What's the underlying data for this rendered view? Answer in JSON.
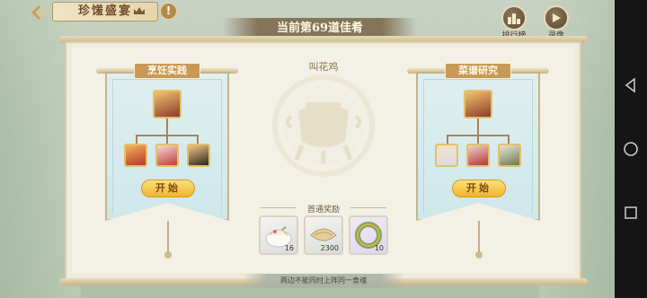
{
  "header": {
    "title": "珍馐盛宴",
    "round_banner": "当前第69道佳肴",
    "info_glyph": "!",
    "buttons": [
      {
        "label": "排行榜",
        "icon": "leaderboard-icon"
      },
      {
        "label": "录像",
        "icon": "play-icon"
      }
    ]
  },
  "dish": {
    "name": "叫花鸡"
  },
  "teams": {
    "left": {
      "heading": "烹饪实践",
      "start_label": "开始"
    },
    "right": {
      "heading": "菜谱研究",
      "start_label": "开始"
    }
  },
  "rewards": {
    "title": "首通奖励",
    "items": [
      {
        "icon": "dumpling-icon",
        "qty": "16"
      },
      {
        "icon": "shell-ingredient-icon",
        "qty": "2300"
      },
      {
        "icon": "jade-ring-icon",
        "qty": "10"
      }
    ]
  },
  "hint": "两边不能同时上阵同一食魂",
  "colors": {
    "accent": "#c79a58",
    "button": "#f0b42e",
    "banner_cloth": "#cfe7ea"
  }
}
